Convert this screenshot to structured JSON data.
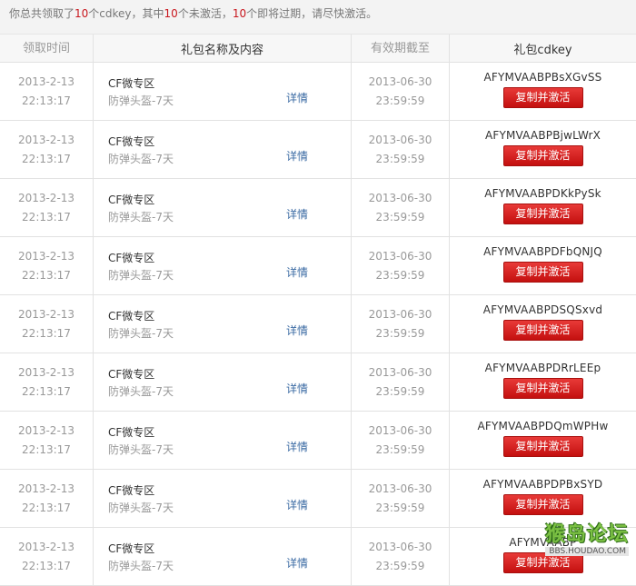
{
  "summary": {
    "p1": "你总共领取了",
    "n1": "10",
    "p2": "个cdkey，其中",
    "n2": "10",
    "p3": "个未激活，",
    "n3": "10",
    "p4": "个即将过期，请尽快激活。"
  },
  "headers": {
    "time": "领取时间",
    "gift": "礼包名称及内容",
    "expiry": "有效期截至",
    "cdkey": "礼包cdkey"
  },
  "rows": [
    {
      "date": "2013-2-13",
      "time": "22:13:17",
      "gift_name": "CF微专区",
      "gift_item": "防弹头盔-7天",
      "detail": "详情",
      "exp_date": "2013-06-30",
      "exp_time": "23:59:59",
      "key": "AFYMVAABPBsXGvSS",
      "button": "复制并激活"
    },
    {
      "date": "2013-2-13",
      "time": "22:13:17",
      "gift_name": "CF微专区",
      "gift_item": "防弹头盔-7天",
      "detail": "详情",
      "exp_date": "2013-06-30",
      "exp_time": "23:59:59",
      "key": "AFYMVAABPBjwLWrX",
      "button": "复制并激活"
    },
    {
      "date": "2013-2-13",
      "time": "22:13:17",
      "gift_name": "CF微专区",
      "gift_item": "防弹头盔-7天",
      "detail": "详情",
      "exp_date": "2013-06-30",
      "exp_time": "23:59:59",
      "key": "AFYMVAABPDKkPySk",
      "button": "复制并激活"
    },
    {
      "date": "2013-2-13",
      "time": "22:13:17",
      "gift_name": "CF微专区",
      "gift_item": "防弹头盔-7天",
      "detail": "详情",
      "exp_date": "2013-06-30",
      "exp_time": "23:59:59",
      "key": "AFYMVAABPDFbQNJQ",
      "button": "复制并激活"
    },
    {
      "date": "2013-2-13",
      "time": "22:13:17",
      "gift_name": "CF微专区",
      "gift_item": "防弹头盔-7天",
      "detail": "详情",
      "exp_date": "2013-06-30",
      "exp_time": "23:59:59",
      "key": "AFYMVAABPDSQSxvd",
      "button": "复制并激活"
    },
    {
      "date": "2013-2-13",
      "time": "22:13:17",
      "gift_name": "CF微专区",
      "gift_item": "防弹头盔-7天",
      "detail": "详情",
      "exp_date": "2013-06-30",
      "exp_time": "23:59:59",
      "key": "AFYMVAABPDRrLEEp",
      "button": "复制并激活"
    },
    {
      "date": "2013-2-13",
      "time": "22:13:17",
      "gift_name": "CF微专区",
      "gift_item": "防弹头盔-7天",
      "detail": "详情",
      "exp_date": "2013-06-30",
      "exp_time": "23:59:59",
      "key": "AFYMVAABPDQmWPHw",
      "button": "复制并激活"
    },
    {
      "date": "2013-2-13",
      "time": "22:13:17",
      "gift_name": "CF微专区",
      "gift_item": "防弹头盔-7天",
      "detail": "详情",
      "exp_date": "2013-06-30",
      "exp_time": "23:59:59",
      "key": "AFYMVAABPDPBxSYD",
      "button": "复制并激活"
    },
    {
      "date": "2013-2-13",
      "time": "22:13:17",
      "gift_name": "CF微专区",
      "gift_item": "防弹头盔-7天",
      "detail": "详情",
      "exp_date": "2013-06-30",
      "exp_time": "23:59:59",
      "key": "AFYMVAABP",
      "button": "复制并激活"
    }
  ],
  "watermark": {
    "main": "猴岛论坛",
    "sub": "BBS.HOUDAO.COM"
  },
  "colors": {
    "accent_red": "#c8161d",
    "link_blue": "#3a6aa3"
  }
}
